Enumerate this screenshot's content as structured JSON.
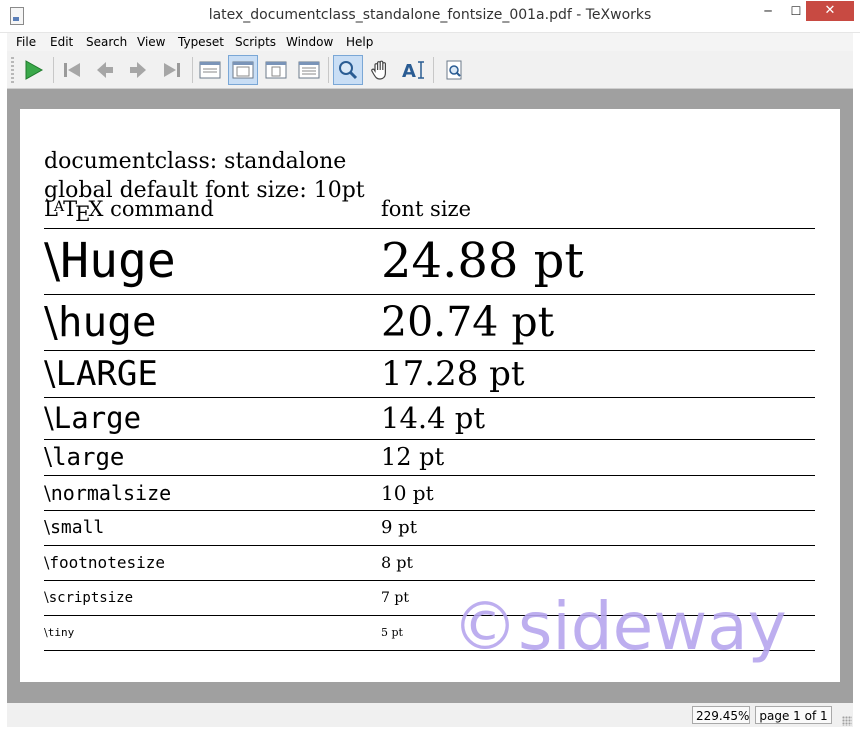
{
  "window": {
    "title": "latex_documentclass_standalone_fontsize_001a.pdf - TeXworks",
    "min_glyph": "─",
    "max_glyph": "☐",
    "close_glyph": "✕"
  },
  "menu": {
    "items": [
      "File",
      "Edit",
      "Search",
      "View",
      "Typeset",
      "Scripts",
      "Window",
      "Help"
    ]
  },
  "toolbar": {
    "buttons": [
      {
        "icon": "typeset-play-icon"
      },
      {
        "icon": "first-page-icon"
      },
      {
        "icon": "previous-page-icon"
      },
      {
        "icon": "next-page-icon"
      },
      {
        "icon": "last-page-icon"
      },
      {
        "icon": "actual-size-icon"
      },
      {
        "icon": "fit-width-icon",
        "active": true
      },
      {
        "icon": "fit-page-icon"
      },
      {
        "icon": "fit-content-icon"
      },
      {
        "icon": "magnifier-icon",
        "active": true
      },
      {
        "icon": "hand-scroll-icon"
      },
      {
        "icon": "select-text-icon"
      },
      {
        "icon": "goto-source-icon"
      }
    ]
  },
  "document": {
    "line1": "documentclass: standalone",
    "line2": "global default font size: 10pt",
    "col_command": "command",
    "col_fontsize": "font size",
    "latex_logo": {
      "L": "L",
      "A": "A",
      "T": "T",
      "E": "E",
      "X": "X"
    },
    "backslash": "\\",
    "rows": [
      {
        "command": "Huge",
        "size": "24.88 pt"
      },
      {
        "command": "huge",
        "size": "20.74 pt"
      },
      {
        "command": "LARGE",
        "size": "17.28 pt"
      },
      {
        "command": "Large",
        "size": "14.4 pt"
      },
      {
        "command": "large",
        "size": "12 pt"
      },
      {
        "command": "normalsize",
        "size": "10 pt"
      },
      {
        "command": "small",
        "size": "9 pt"
      },
      {
        "command": "footnotesize",
        "size": "8 pt"
      },
      {
        "command": "scriptsize",
        "size": "7 pt"
      },
      {
        "command": "tiny",
        "size": "5 pt"
      }
    ],
    "watermark": "©sideway"
  },
  "status": {
    "zoom": "229.45%",
    "page": "page 1 of 1"
  },
  "colors": {
    "accent": "#c9def5",
    "close_button": "#c84a42",
    "viewer_background": "#a0a0a0",
    "watermark": "#b6a6ee"
  }
}
